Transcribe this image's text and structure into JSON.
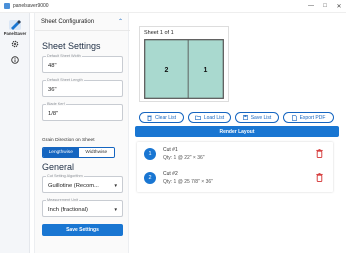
{
  "window": {
    "title": "panelsaver9000",
    "minimize": "—",
    "maximize": "□",
    "close": "✕"
  },
  "rail": {
    "app_name": "PanelSaver",
    "icons": [
      "logo-icon",
      "gear-icon",
      "info-icon"
    ]
  },
  "panel": {
    "header": "Sheet Configuration",
    "collapse_glyph": "⌃",
    "sheet_settings_title": "Sheet Settings",
    "sheet_width": {
      "label": "Default Sheet Width",
      "value": "48\""
    },
    "sheet_length": {
      "label": "Default Sheet Length",
      "value": "36\""
    },
    "blade_kerf": {
      "label": "Blade Kerf",
      "value": "1/8\""
    },
    "grain_label": "Grain Direction on Sheet",
    "grain_options": [
      "Lengthwise",
      "Widthwise"
    ],
    "grain_selected": "Lengthwise",
    "general_title": "General",
    "algorithm": {
      "label": "Cut Setting Algorithm",
      "value": "Guillotine (Recom..."
    },
    "measurement": {
      "label": "Measurement Unit",
      "value": "Inch (fractional)"
    },
    "save_button": "Save Settings"
  },
  "sheet_preview": {
    "title": "Sheet 1 of 1",
    "pieces": [
      "2",
      "1"
    ]
  },
  "actions": {
    "clear": "Clear List",
    "load": "Load List",
    "save": "Save List",
    "export": "Export PDF",
    "render": "Render Layout"
  },
  "cuts": [
    {
      "number": "1",
      "name": "Cut #1",
      "qty": "Qty: 1 @ 22\" × 36\""
    },
    {
      "number": "2",
      "name": "Cut #2",
      "qty": "Qty: 1 @ 25 7/8\" × 36\""
    }
  ],
  "colors": {
    "accent": "#1976d2",
    "piece_fill": "#a9d9cf",
    "delete": "#d32f2f"
  }
}
